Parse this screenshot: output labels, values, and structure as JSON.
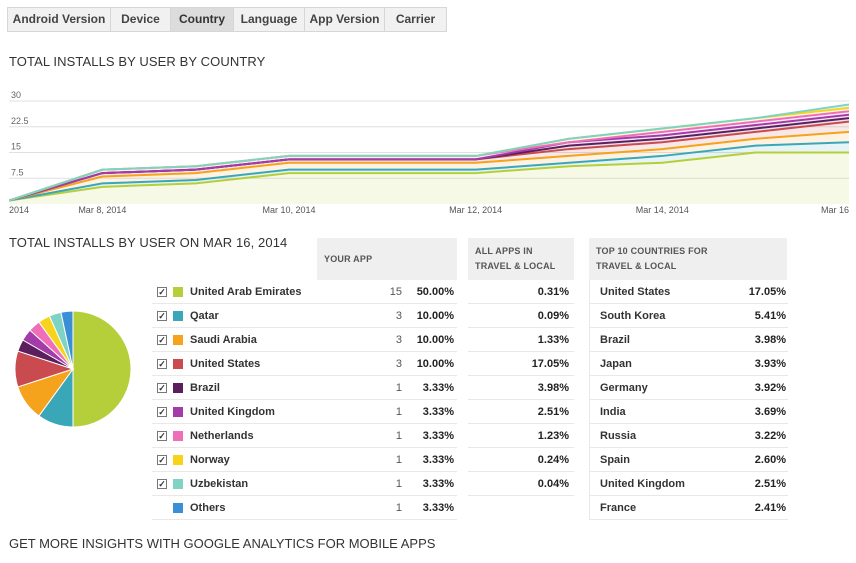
{
  "tabs": [
    {
      "label": "Android Version",
      "active": false
    },
    {
      "label": "Device",
      "active": false
    },
    {
      "label": "Country",
      "active": true
    },
    {
      "label": "Language",
      "active": false
    },
    {
      "label": "App Version",
      "active": false
    },
    {
      "label": "Carrier",
      "active": false
    }
  ],
  "titles": {
    "total_by_country": "TOTAL INSTALLS BY USER BY COUNTRY",
    "total_on_date": "TOTAL INSTALLS BY USER ON MAR 16, 2014",
    "insights": "GET MORE INSIGHTS WITH GOOGLE ANALYTICS FOR MOBILE APPS"
  },
  "table_headers": {
    "your_app": "YOUR APP",
    "all_apps_line1": "ALL APPS IN",
    "all_apps_line2": "TRAVEL & LOCAL",
    "top10_line1": "TOP 10 COUNTRIES FOR",
    "top10_line2": "TRAVEL & LOCAL"
  },
  "rows": [
    {
      "country": "United Arab Emirates",
      "color": "#b5cf3a",
      "checked": true,
      "count": "15",
      "pct": "50.00%",
      "all_apps": "0.31%"
    },
    {
      "country": "Qatar",
      "color": "#3aa7b8",
      "checked": true,
      "count": "3",
      "pct": "10.00%",
      "all_apps": "0.09%"
    },
    {
      "country": "Saudi Arabia",
      "color": "#f5a21c",
      "checked": true,
      "count": "3",
      "pct": "10.00%",
      "all_apps": "1.33%"
    },
    {
      "country": "United States",
      "color": "#c94a4f",
      "checked": true,
      "count": "3",
      "pct": "10.00%",
      "all_apps": "17.05%"
    },
    {
      "country": "Brazil",
      "color": "#5b1f5e",
      "checked": true,
      "count": "1",
      "pct": "3.33%",
      "all_apps": "3.98%"
    },
    {
      "country": "United Kingdom",
      "color": "#a33ba8",
      "checked": true,
      "count": "1",
      "pct": "3.33%",
      "all_apps": "2.51%"
    },
    {
      "country": "Netherlands",
      "color": "#ee6fb8",
      "checked": true,
      "count": "1",
      "pct": "3.33%",
      "all_apps": "1.23%"
    },
    {
      "country": "Norway",
      "color": "#f7d31c",
      "checked": true,
      "count": "1",
      "pct": "3.33%",
      "all_apps": "0.24%"
    },
    {
      "country": "Uzbekistan",
      "color": "#7fd3c4",
      "checked": true,
      "count": "1",
      "pct": "3.33%",
      "all_apps": "0.04%"
    },
    {
      "country": "Others",
      "color": "#3a8fd6",
      "checked": false,
      "count": "1",
      "pct": "3.33%",
      "all_apps": ""
    }
  ],
  "top10": [
    {
      "country": "United States",
      "pct": "17.05%"
    },
    {
      "country": "South Korea",
      "pct": "5.41%"
    },
    {
      "country": "Brazil",
      "pct": "3.98%"
    },
    {
      "country": "Japan",
      "pct": "3.93%"
    },
    {
      "country": "Germany",
      "pct": "3.92%"
    },
    {
      "country": "India",
      "pct": "3.69%"
    },
    {
      "country": "Russia",
      "pct": "3.22%"
    },
    {
      "country": "Spain",
      "pct": "2.60%"
    },
    {
      "country": "United Kingdom",
      "pct": "2.51%"
    },
    {
      "country": "France",
      "pct": "2.41%"
    }
  ],
  "chart_data": [
    {
      "type": "area",
      "title": "TOTAL INSTALLS BY USER BY COUNTRY",
      "ylim": [
        0,
        30
      ],
      "y_ticks": [
        "7.5",
        "15",
        "22.5",
        "30"
      ],
      "x_tick_labels": [
        "2014",
        "Mar 8, 2014",
        "Mar 10, 2014",
        "Mar 12, 2014",
        "Mar 14, 2014",
        "Mar 16"
      ],
      "x": [
        "Mar 7",
        "Mar 8",
        "Mar 9",
        "Mar 10",
        "Mar 11",
        "Mar 12",
        "Mar 13",
        "Mar 14",
        "Mar 15",
        "Mar 16"
      ],
      "stacked": true,
      "series": [
        {
          "name": "United Arab Emirates",
          "color": "#b5cf3a",
          "values": [
            1,
            5,
            6,
            9,
            9,
            9,
            11,
            12,
            15,
            15
          ]
        },
        {
          "name": "Qatar",
          "color": "#3aa7b8",
          "values": [
            0,
            1,
            1,
            1,
            1,
            1,
            1,
            2,
            2,
            3
          ]
        },
        {
          "name": "Saudi Arabia",
          "color": "#f5a21c",
          "values": [
            0,
            2,
            2,
            2,
            2,
            2,
            2,
            2,
            2,
            3
          ]
        },
        {
          "name": "United States",
          "color": "#c94a4f",
          "values": [
            0,
            1,
            1,
            1,
            1,
            1,
            2,
            2,
            2,
            3
          ]
        },
        {
          "name": "Brazil",
          "color": "#5b1f5e",
          "values": [
            0,
            0,
            0,
            0,
            0,
            0,
            1,
            1,
            1,
            1
          ]
        },
        {
          "name": "United Kingdom",
          "color": "#a33ba8",
          "values": [
            0,
            0,
            0,
            0,
            0,
            0,
            1,
            1,
            1,
            1
          ]
        },
        {
          "name": "Netherlands",
          "color": "#ee6fb8",
          "values": [
            0,
            1,
            1,
            1,
            1,
            1,
            0,
            1,
            1,
            1
          ]
        },
        {
          "name": "Norway",
          "color": "#f7d31c",
          "values": [
            0,
            0,
            0,
            0,
            0,
            0,
            1,
            1,
            1,
            1
          ]
        },
        {
          "name": "Uzbekistan",
          "color": "#7fd3c4",
          "values": [
            0,
            0,
            0,
            0,
            0,
            0,
            0,
            0,
            0,
            1
          ]
        }
      ]
    },
    {
      "type": "pie",
      "title": "TOTAL INSTALLS BY USER ON MAR 16, 2014",
      "labels": [
        "United Arab Emirates",
        "Qatar",
        "Saudi Arabia",
        "United States",
        "Brazil",
        "United Kingdom",
        "Netherlands",
        "Norway",
        "Uzbekistan",
        "Others"
      ],
      "values": [
        15,
        3,
        3,
        3,
        1,
        1,
        1,
        1,
        1,
        1
      ],
      "colors": [
        "#b5cf3a",
        "#3aa7b8",
        "#f5a21c",
        "#c94a4f",
        "#5b1f5e",
        "#a33ba8",
        "#ee6fb8",
        "#f7d31c",
        "#7fd3c4",
        "#3a8fd6"
      ]
    }
  ]
}
